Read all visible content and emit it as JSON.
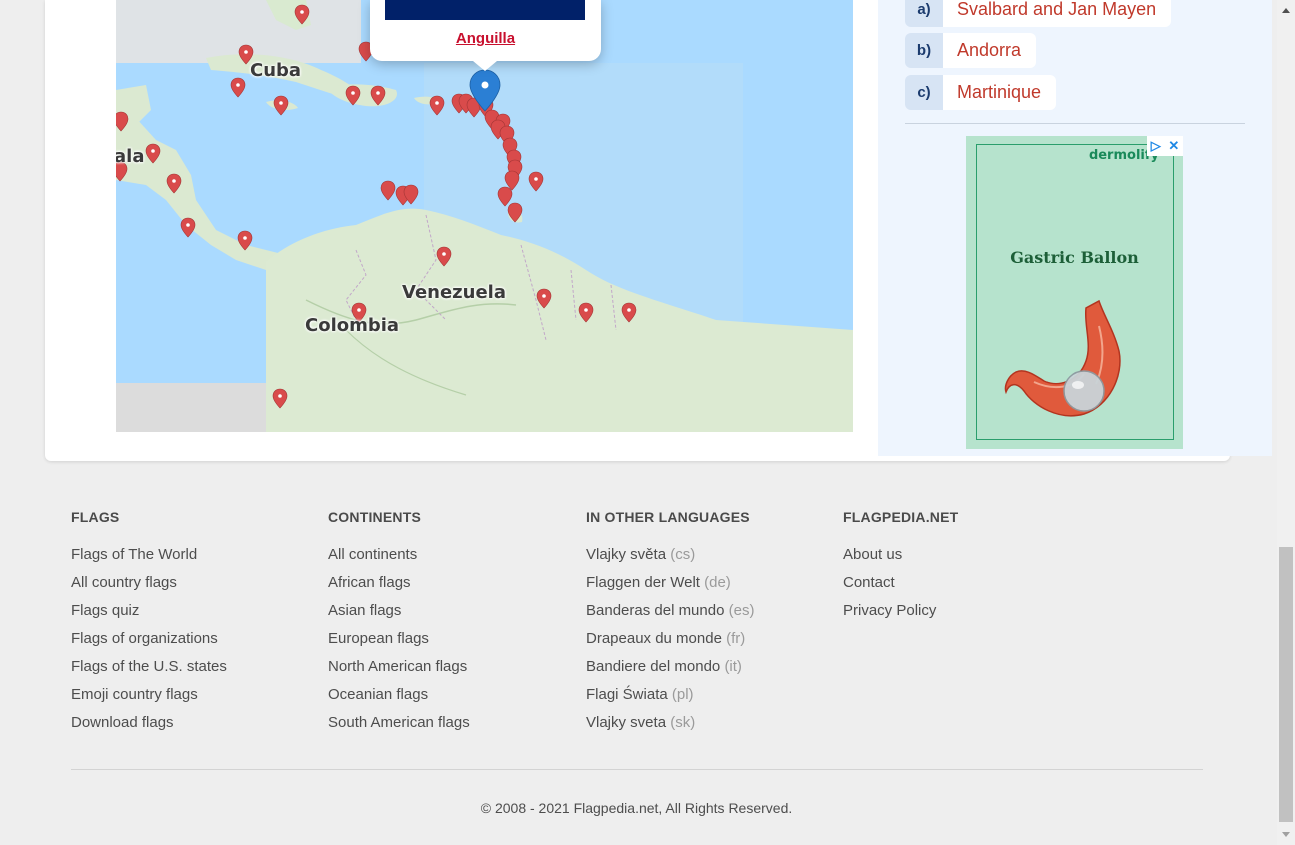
{
  "map": {
    "popup_country": "Anguilla",
    "labels": {
      "cuba": "Cuba",
      "guatemala_partial": "ala",
      "venezuela": "Venezuela",
      "colombia": "Colombia"
    }
  },
  "quiz": {
    "answers": [
      {
        "letter": "a)",
        "text": "Svalbard and Jan Mayen"
      },
      {
        "letter": "b)",
        "text": "Andorra"
      },
      {
        "letter": "c)",
        "text": "Martinique"
      }
    ]
  },
  "ad": {
    "brand": "dermolify",
    "headline": "Gastric Ballon",
    "adchoices_icon": "adchoices-icon",
    "close_icon": "close-icon"
  },
  "footer": {
    "columns": [
      {
        "title": "FLAGS",
        "links": [
          "Flags of The World",
          "All country flags",
          "Flags quiz",
          "Flags of organizations",
          "Flags of the U.S. states",
          "Emoji country flags",
          "Download flags"
        ]
      },
      {
        "title": "CONTINENTS",
        "links": [
          "All continents",
          "African flags",
          "Asian flags",
          "European flags",
          "North American flags",
          "Oceanian flags",
          "South American flags"
        ]
      },
      {
        "title": "IN OTHER LANGUAGES",
        "links": [
          {
            "text": "Vlajky světa",
            "code": "(cs)"
          },
          {
            "text": "Flaggen der Welt",
            "code": "(de)"
          },
          {
            "text": "Banderas del mundo",
            "code": "(es)"
          },
          {
            "text": "Drapeaux du monde",
            "code": "(fr)"
          },
          {
            "text": "Bandiere del mondo",
            "code": "(it)"
          },
          {
            "text": "Flagi Świata",
            "code": "(pl)"
          },
          {
            "text": "Vlajky sveta",
            "code": "(sk)"
          }
        ]
      },
      {
        "title": "FLAGPEDIA.NET",
        "links": [
          "About us",
          "Contact",
          "Privacy Policy"
        ]
      }
    ],
    "copyright": "© 2008 - 2021 Flagpedia.net, All Rights Reserved."
  },
  "colors": {
    "accent_red": "#c0392b",
    "pin_red": "#d94b4b",
    "selected_pin_blue": "#2b7fd4",
    "popup_flag_navy": "#012169"
  }
}
